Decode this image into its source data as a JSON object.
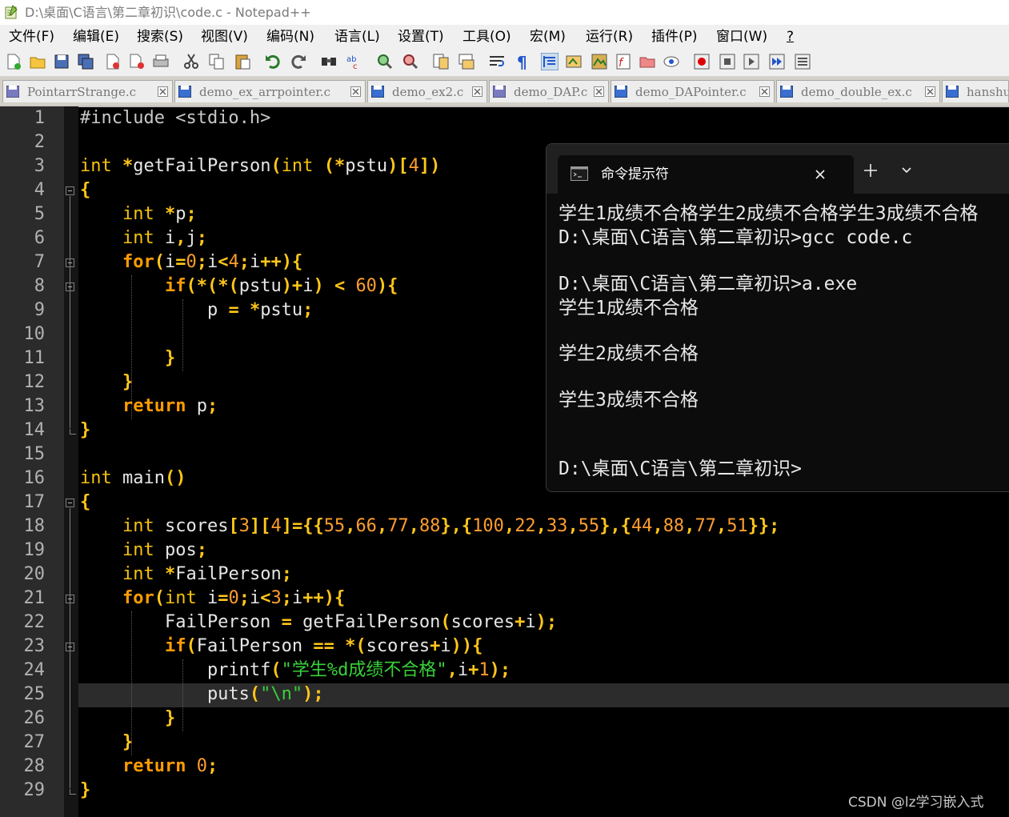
{
  "window": {
    "title": "D:\\桌面\\C语言\\第二章初识\\code.c - Notepad++"
  },
  "menu": [
    "文件(F)",
    "编辑(E)",
    "搜索(S)",
    "视图(V)",
    "编码(N)",
    "语言(L)",
    "设置(T)",
    "工具(O)",
    "宏(M)",
    "运行(R)",
    "插件(P)",
    "窗口(W)",
    "?"
  ],
  "toolbar_icons": [
    "new-file-icon",
    "open-file-icon",
    "save-icon",
    "save-all-icon",
    "close-icon",
    "close-all-icon",
    "print-icon",
    "cut-icon",
    "copy-icon",
    "paste-icon",
    "undo-icon",
    "redo-icon",
    "find-icon",
    "replace-icon",
    "zoom-in-icon",
    "zoom-out-icon",
    "sync-v-icon",
    "sync-h-icon",
    "word-wrap-icon",
    "show-all-chars-icon",
    "indent-guide-icon",
    "lang-icon",
    "doc-map-icon",
    "func-list-icon",
    "folder-workspace-icon",
    "monitor-icon",
    "record-macro-icon",
    "stop-macro-icon",
    "play-macro-icon",
    "run-macro-multi-icon",
    "save-macro-icon"
  ],
  "tabs": [
    "PointarrStrange.c",
    "demo_ex_arrpointer.c",
    "demo_ex2.c",
    "demo_DAP.c",
    "demo_DAPointer.c",
    "demo_double_ex.c",
    "hanshu"
  ],
  "editor": {
    "line_numbers": [
      "1",
      "2",
      "3",
      "4",
      "5",
      "6",
      "7",
      "8",
      "9",
      "10",
      "11",
      "12",
      "13",
      "14",
      "15",
      "16",
      "17",
      "18",
      "19",
      "20",
      "21",
      "22",
      "23",
      "24",
      "25",
      "26",
      "27",
      "28",
      "29"
    ],
    "current_line": 25,
    "lines": [
      "#include <stdio.h>",
      "",
      "int *getFailPerson(int (*pstu)[4])",
      "{",
      "    int *p;",
      "    int i,j;",
      "    for(i=0;i<4;i++){",
      "        if(*(*(pstu)+i) < 60){",
      "            p = *pstu;",
      "",
      "        }",
      "    }",
      "    return p;",
      "}",
      "",
      "int main()",
      "{",
      "    int scores[3][4]={{55,66,77,88},{100,22,33,55},{44,88,77,51}};",
      "    int pos;",
      "    int *FailPerson;",
      "    for(int i=0;i<3;i++){",
      "        FailPerson = getFailPerson(scores+i);",
      "        if(FailPerson == *(scores+i)){",
      "            printf(\"学生%d成绩不合格\",i+1);",
      "            puts(\"\\n\");",
      "        }",
      "    }",
      "    return 0;",
      "}"
    ]
  },
  "terminal": {
    "tab_title": "命令提示符",
    "lines": [
      "学生1成绩不合格学生2成绩不合格学生3成绩不合格",
      "D:\\桌面\\C语言\\第二章初识>gcc code.c",
      "",
      "D:\\桌面\\C语言\\第二章初识>a.exe",
      "学生1成绩不合格",
      "",
      "学生2成绩不合格",
      "",
      "学生3成绩不合格",
      "",
      "",
      "D:\\桌面\\C语言\\第二章初识>"
    ]
  },
  "watermark": "CSDN @lz学习嵌入式"
}
